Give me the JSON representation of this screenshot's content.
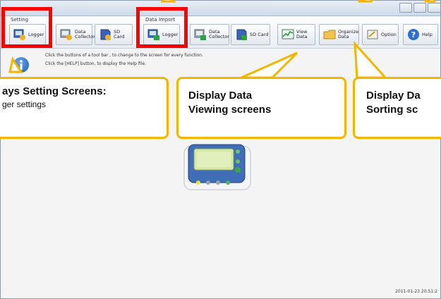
{
  "toolbar": {
    "setting_label": "Setting",
    "import_label": "Data Import",
    "buttons": [
      {
        "id": "setting-logger",
        "label": "Logger"
      },
      {
        "id": "setting-collector",
        "label": "Data\nCollector"
      },
      {
        "id": "setting-sdcard",
        "label": "SD Card"
      },
      {
        "id": "import-logger",
        "label": "Logger"
      },
      {
        "id": "import-collector",
        "label": "Data\nCollector"
      },
      {
        "id": "import-sdcard",
        "label": "SD Card"
      },
      {
        "id": "view-data",
        "label": "View\nData"
      },
      {
        "id": "organize-data",
        "label": "Organize\nData"
      },
      {
        "id": "option",
        "label": "Option"
      },
      {
        "id": "help",
        "label": "Help"
      }
    ]
  },
  "info": {
    "line1": "Click the buttons of a tool bar , to change to the screen for every function.",
    "line2": "Click the [HELP] button, to display the Help file."
  },
  "callouts": {
    "setting_title": "ays Setting Screens:",
    "setting_sub": "ger settings",
    "view_title1": "Display Data",
    "view_title2": "Viewing screens",
    "sort_title1": "Display Da",
    "sort_title2": "Sorting sc"
  },
  "status": {
    "datetime": "2011-01-23 20:51:2"
  },
  "colors": {
    "highlight": "#ff0000",
    "callout_border": "#f5b400"
  }
}
